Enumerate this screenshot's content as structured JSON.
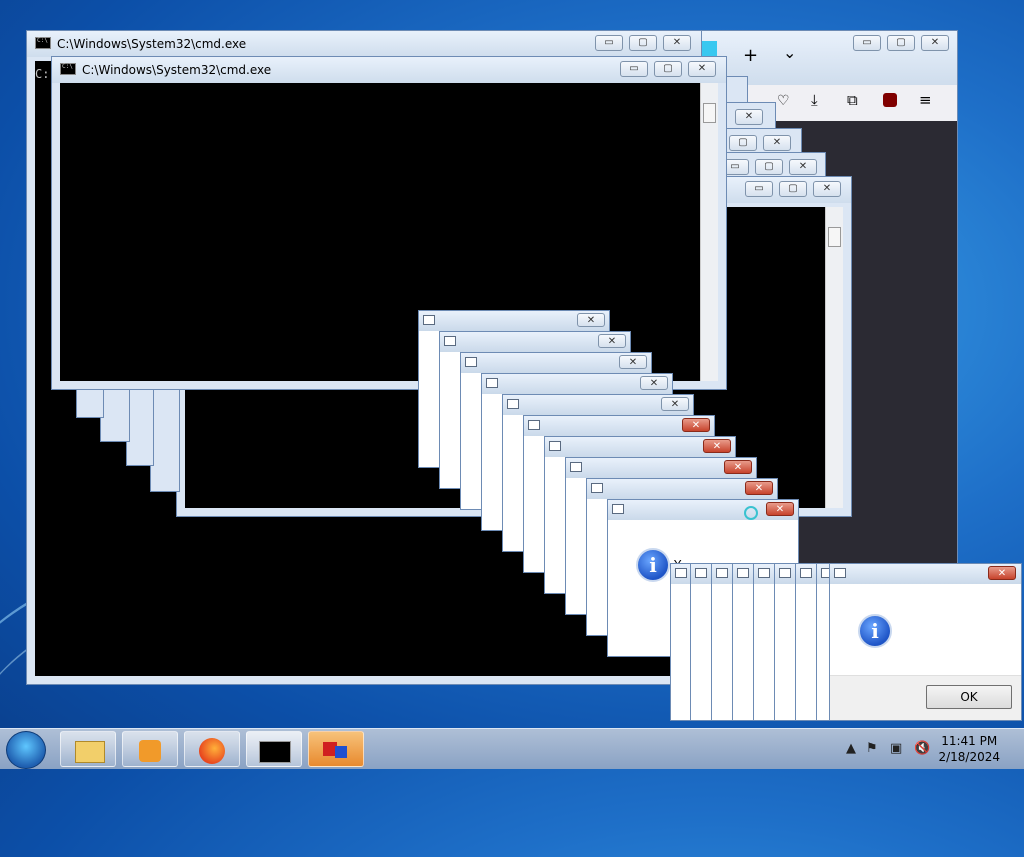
{
  "windows": {
    "cmd_title_back": "C:\\Windows\\System32\\cmd.exe",
    "cmd_title_front": "C:\\Windows\\System32\\cmd.exe",
    "console_prompt_fragment": "C:"
  },
  "caption_buttons": {
    "minimize": "▭",
    "maximize": "▢",
    "close": "✕"
  },
  "firefox_toolbar": {
    "new_tab": "+",
    "tab_list": "⌄",
    "icons": [
      "pocket-icon",
      "download-icon",
      "extensions-icon",
      "ublock-icon",
      "menu-icon"
    ]
  },
  "message_box": {
    "text_fragment": "Y",
    "ok_label": "OK"
  },
  "taskbar": {
    "items": [
      "start-button",
      "explorer-icon",
      "media-player-icon",
      "firefox-icon",
      "cmd-icon",
      "app-icon"
    ],
    "clock_time": "11:41 PM",
    "clock_date": "2/18/2024",
    "tray_show_hidden": "▲"
  },
  "colors": {
    "console_bg": "#000000",
    "aero_frame": "#dbe6f4",
    "close_red": "#c7432c"
  }
}
